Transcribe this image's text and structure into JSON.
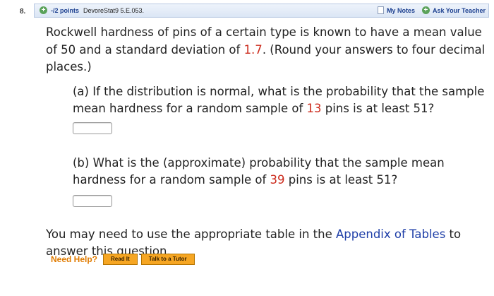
{
  "question": {
    "number": "8.",
    "points": "-/2 points",
    "id": "DevoreStat9 5.E.053.",
    "my_notes": "My Notes",
    "ask_teacher": "Ask Your Teacher"
  },
  "body": {
    "intro_1": "Rockwell hardness of pins of a certain type is known to have a mean value of 50 and a standard deviation of ",
    "sd": "1.7",
    "intro_2": ". (Round your answers to four decimal places.)",
    "part_a_1": "(a) If the distribution is normal, what is the probability that the sample mean hardness for a random sample of ",
    "part_a_n": "13",
    "part_a_2": " pins is at least 51?",
    "part_b_1": "(b) What is the (approximate) probability that the sample mean hardness for a random sample of ",
    "part_b_n": "39",
    "part_b_2": " pins is at least 51?",
    "footer_1": "You may need to use the appropriate table in the ",
    "footer_link": "Appendix of Tables",
    "footer_2": " to answer this question."
  },
  "help": {
    "label": "Need Help?",
    "read_it": "Read It",
    "talk_tutor": "Talk to a Tutor"
  },
  "colors": {
    "accent_red": "#cc2b1d",
    "link_blue": "#1f3fa8",
    "help_orange": "#e07b00"
  }
}
